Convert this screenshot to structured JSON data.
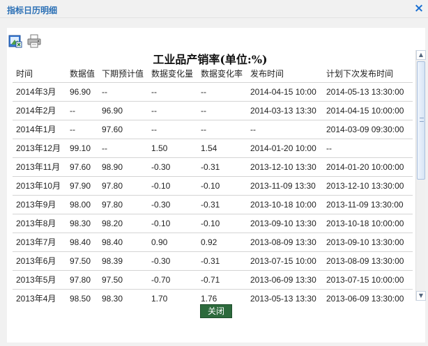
{
  "dialog": {
    "title": "指标日历明细",
    "close_icon": "×"
  },
  "toolbar": {
    "export_icon": "excel-export-icon",
    "print_icon": "printer-icon"
  },
  "table": {
    "title": "工业品产销率(单位:%)",
    "headers": [
      "时间",
      "数据值",
      "下期预计值",
      "数据变化量",
      "数据变化率",
      "发布时间",
      "计划下次发布时间"
    ],
    "rows": [
      [
        "2014年3月",
        "96.90",
        "--",
        "--",
        "--",
        "2014-04-15 10:00",
        "2014-05-13 13:30:00"
      ],
      [
        "2014年2月",
        "--",
        "96.90",
        "--",
        "--",
        "2014-03-13 13:30",
        "2014-04-15 10:00:00"
      ],
      [
        "2014年1月",
        "--",
        "97.60",
        "--",
        "--",
        "--",
        "2014-03-09 09:30:00"
      ],
      [
        "2013年12月",
        "99.10",
        "--",
        "1.50",
        "1.54",
        "2014-01-20 10:00",
        "--"
      ],
      [
        "2013年11月",
        "97.60",
        "98.90",
        "-0.30",
        "-0.31",
        "2013-12-10 13:30",
        "2014-01-20 10:00:00"
      ],
      [
        "2013年10月",
        "97.90",
        "97.80",
        "-0.10",
        "-0.10",
        "2013-11-09 13:30",
        "2013-12-10 13:30:00"
      ],
      [
        "2013年9月",
        "98.00",
        "97.80",
        "-0.30",
        "-0.31",
        "2013-10-18 10:00",
        "2013-11-09 13:30:00"
      ],
      [
        "2013年8月",
        "98.30",
        "98.20",
        "-0.10",
        "-0.10",
        "2013-09-10 13:30",
        "2013-10-18 10:00:00"
      ],
      [
        "2013年7月",
        "98.40",
        "98.40",
        "0.90",
        "0.92",
        "2013-08-09 13:30",
        "2013-09-10 13:30:00"
      ],
      [
        "2013年6月",
        "97.50",
        "98.39",
        "-0.30",
        "-0.31",
        "2013-07-15 10:00",
        "2013-08-09 13:30:00"
      ],
      [
        "2013年5月",
        "97.80",
        "97.50",
        "-0.70",
        "-0.71",
        "2013-06-09 13:30",
        "2013-07-15 10:00:00"
      ],
      [
        "2013年4月",
        "98.50",
        "98.30",
        "1.70",
        "1.76",
        "2013-05-13 13:30",
        "2013-06-09 13:30:00"
      ]
    ]
  },
  "scrollbar": {
    "up_icon": "▲",
    "down_icon": "▼"
  },
  "footer": {
    "close_label": "关闭"
  },
  "colors": {
    "title_text": "#2a6fb5",
    "close_icon": "#1a6fd1",
    "close_button_bg": "#2c6a3c"
  }
}
